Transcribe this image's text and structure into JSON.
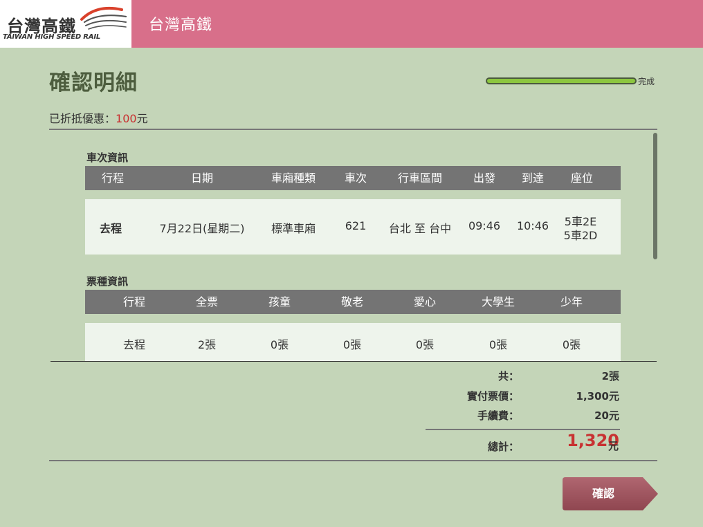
{
  "header": {
    "logo_cn": "台灣高鐵",
    "logo_en": "TAIWAN HIGH SPEED RAIL",
    "title": "台灣高鐵",
    "bg_color": "#d86f8a"
  },
  "page": {
    "title": "確認明細",
    "progress_label": "完成",
    "progress_fraction": 1.0
  },
  "discount": {
    "label": "已折抵優惠：",
    "amount": "100",
    "unit": "元"
  },
  "train_info": {
    "title": "車次資訊",
    "headers": [
      "行程",
      "日期",
      "車廂種類",
      "車次",
      "行車區間",
      "出發",
      "到達",
      "座位"
    ],
    "row": {
      "trip": "去程",
      "date": "7月22日(星期二)",
      "car_type": "標準車廂",
      "train_no": "621",
      "route": "台北 至 台中",
      "depart": "09:46",
      "arrive": "10:46",
      "seats": [
        "5車2E",
        "5車2D"
      ]
    }
  },
  "ticket_info": {
    "title": "票種資訊",
    "headers": [
      "行程",
      "全票",
      "孩童",
      "敬老",
      "愛心",
      "大學生",
      "少年"
    ],
    "row": [
      "去程",
      "2張",
      "0張",
      "0張",
      "0張",
      "0張",
      "0張"
    ]
  },
  "summary": {
    "count_label": "共：",
    "count_value": "2張",
    "price_label": "實付票價：",
    "price_value": "1,300元",
    "fee_label": "手續費：",
    "fee_value": "20元",
    "total_label": "總計：",
    "total_value": "1,320",
    "total_unit": "元"
  },
  "actions": {
    "confirm_label": "確認"
  },
  "colors": {
    "background": "#c4d5b8",
    "table_header": "#747474",
    "accent_red": "#c83232",
    "button": "#a0525e",
    "progress": "#8cc63f"
  }
}
